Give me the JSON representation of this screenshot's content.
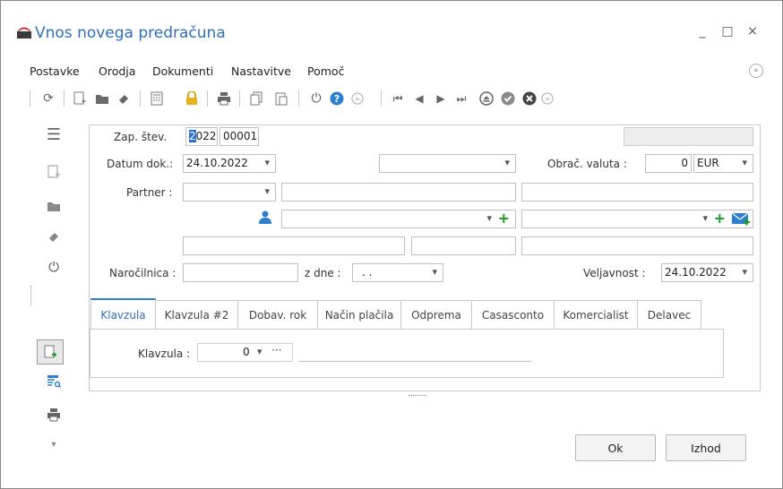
{
  "window": {
    "title": "Vnos novega predračuna",
    "minimize": "_",
    "maximize": "□",
    "close": "×"
  },
  "menu": {
    "items": [
      "Postavke",
      "Orodja",
      "Dokumenti",
      "Nastavitve",
      "Pomoč"
    ]
  },
  "toolbar": {
    "icons": [
      "separator-icon",
      "refresh-icon",
      "new-document-icon",
      "open-folder-icon",
      "eraser-icon",
      "calculator-icon",
      "lock-icon",
      "print-icon",
      "copy-icon",
      "paste-icon",
      "power-icon",
      "help-icon",
      "more-icon",
      "first-record-icon",
      "previous-record-icon",
      "next-record-icon",
      "last-record-icon",
      "eject-icon",
      "confirm-icon",
      "cancel-icon",
      "more-icon"
    ]
  },
  "form": {
    "zap_label": "Zap. štev.",
    "zap_year": "2022",
    "zap_number": "00001",
    "datum_label": "Datum dok.:",
    "datum_value": "24.10.2022",
    "obrac_label": "Obrač. valuta :",
    "obrac_value": "0",
    "currency": "EUR",
    "partner_label": "Partner :",
    "narocilnica_label": "Naročilnica :",
    "z_dne_label": "z dne :",
    "z_dne_value": ". .",
    "veljavnost_label": "Veljavnost :",
    "veljavnost_value": "24.10.2022"
  },
  "tabs": [
    "Klavzula",
    "Klavzula #2",
    "Dobav. rok",
    "Način plačila",
    "Odprema",
    "Casasconto",
    "Komercialist",
    "Delavec"
  ],
  "klavzula": {
    "label": "Klavzula :",
    "value": "0",
    "ellipsis": "···"
  },
  "buttons": {
    "ok": "Ok",
    "exit": "Izhod"
  },
  "colors": {
    "title": "#2e6fb8",
    "accent": "#2e7fd0",
    "add": "#1aa01a"
  }
}
